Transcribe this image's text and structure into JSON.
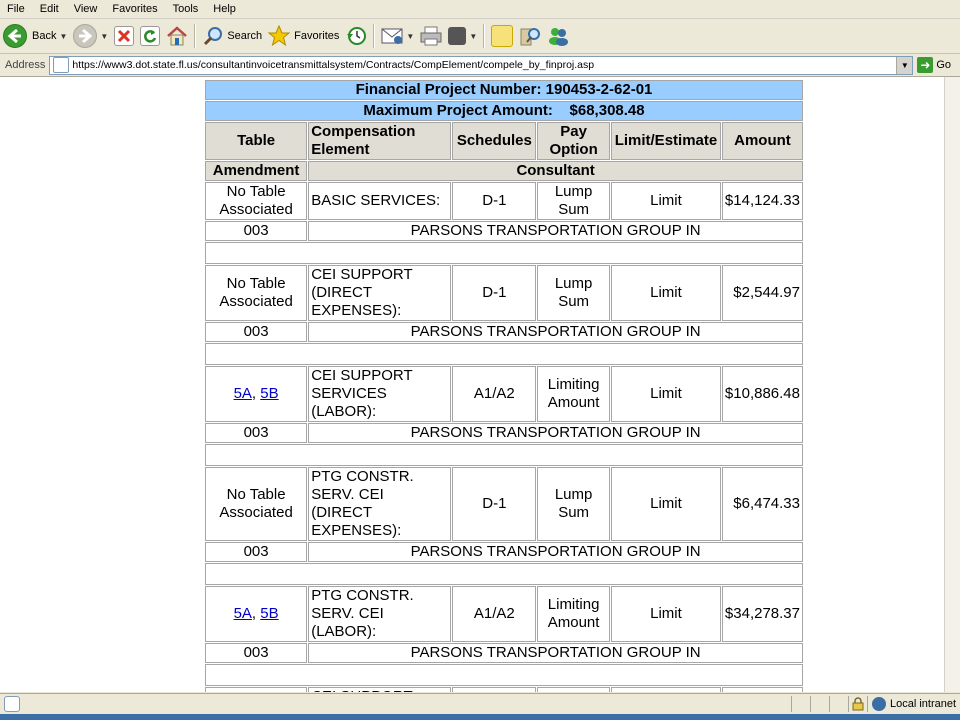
{
  "menu": [
    "File",
    "Edit",
    "View",
    "Favorites",
    "Tools",
    "Help"
  ],
  "toolbar": {
    "back_label": "Back",
    "search_label": "Search",
    "favorites_label": "Favorites"
  },
  "address": {
    "label": "Address",
    "url": "https://www3.dot.state.fl.us/consultantinvoicetransmittalsystem/Contracts/CompElement/compele_by_finproj.asp",
    "go_label": "Go"
  },
  "table": {
    "financial_project": "Financial Project Number: 190453-2-62-01",
    "max_amount_label": "Maximum Project Amount:",
    "max_amount_value": "$68,308.48",
    "headers": {
      "table": "Table",
      "comp_element": "Compensation Element",
      "schedules": "Schedules",
      "pay_option": "Pay Option",
      "limit": "Limit/Estimate",
      "amount": "Amount",
      "amendment": "Amendment",
      "consultant": "Consultant"
    },
    "rows": [
      {
        "table": "No Table Associated",
        "links": [],
        "element": "BASIC SERVICES:",
        "schedule": "D-1",
        "pay": "Lump Sum",
        "limit": "Limit",
        "amount": "$14,124.33",
        "amendment": "003",
        "consultant": "PARSONS TRANSPORTATION GROUP IN"
      },
      {
        "table": "No Table Associated",
        "links": [],
        "element": "CEI SUPPORT (DIRECT EXPENSES):",
        "schedule": "D-1",
        "pay": "Lump Sum",
        "limit": "Limit",
        "amount": "$2,544.97",
        "amendment": "003",
        "consultant": "PARSONS TRANSPORTATION GROUP IN"
      },
      {
        "table": "",
        "links": [
          "5A",
          "5B"
        ],
        "element": "CEI SUPPORT SERVICES (LABOR):",
        "schedule": "A1/A2",
        "pay": "Limiting Amount",
        "limit": "Limit",
        "amount": "$10,886.48",
        "amendment": "003",
        "consultant": "PARSONS TRANSPORTATION GROUP IN"
      },
      {
        "table": "No Table Associated",
        "links": [],
        "element": "PTG CONSTR. SERV. CEI (DIRECT EXPENSES):",
        "schedule": "D-1",
        "pay": "Lump Sum",
        "limit": "Limit",
        "amount": "$6,474.33",
        "amendment": "003",
        "consultant": "PARSONS TRANSPORTATION GROUP IN"
      },
      {
        "table": "",
        "links": [
          "5A",
          "5B"
        ],
        "element": "PTG CONSTR. SERV. CEI (LABOR):",
        "schedule": "A1/A2",
        "pay": "Limiting Amount",
        "limit": "Limit",
        "amount": "$34,278.37",
        "amendment": "003",
        "consultant": "PARSONS TRANSPORTATION GROUP IN"
      }
    ],
    "partial_row_element": "CEI SUPPORT"
  },
  "status": {
    "zone": "Local intranet"
  },
  "colors": {
    "header_blue": "#99ccff",
    "header_gray": "#e0ddd5",
    "link": "#0000cc"
  }
}
